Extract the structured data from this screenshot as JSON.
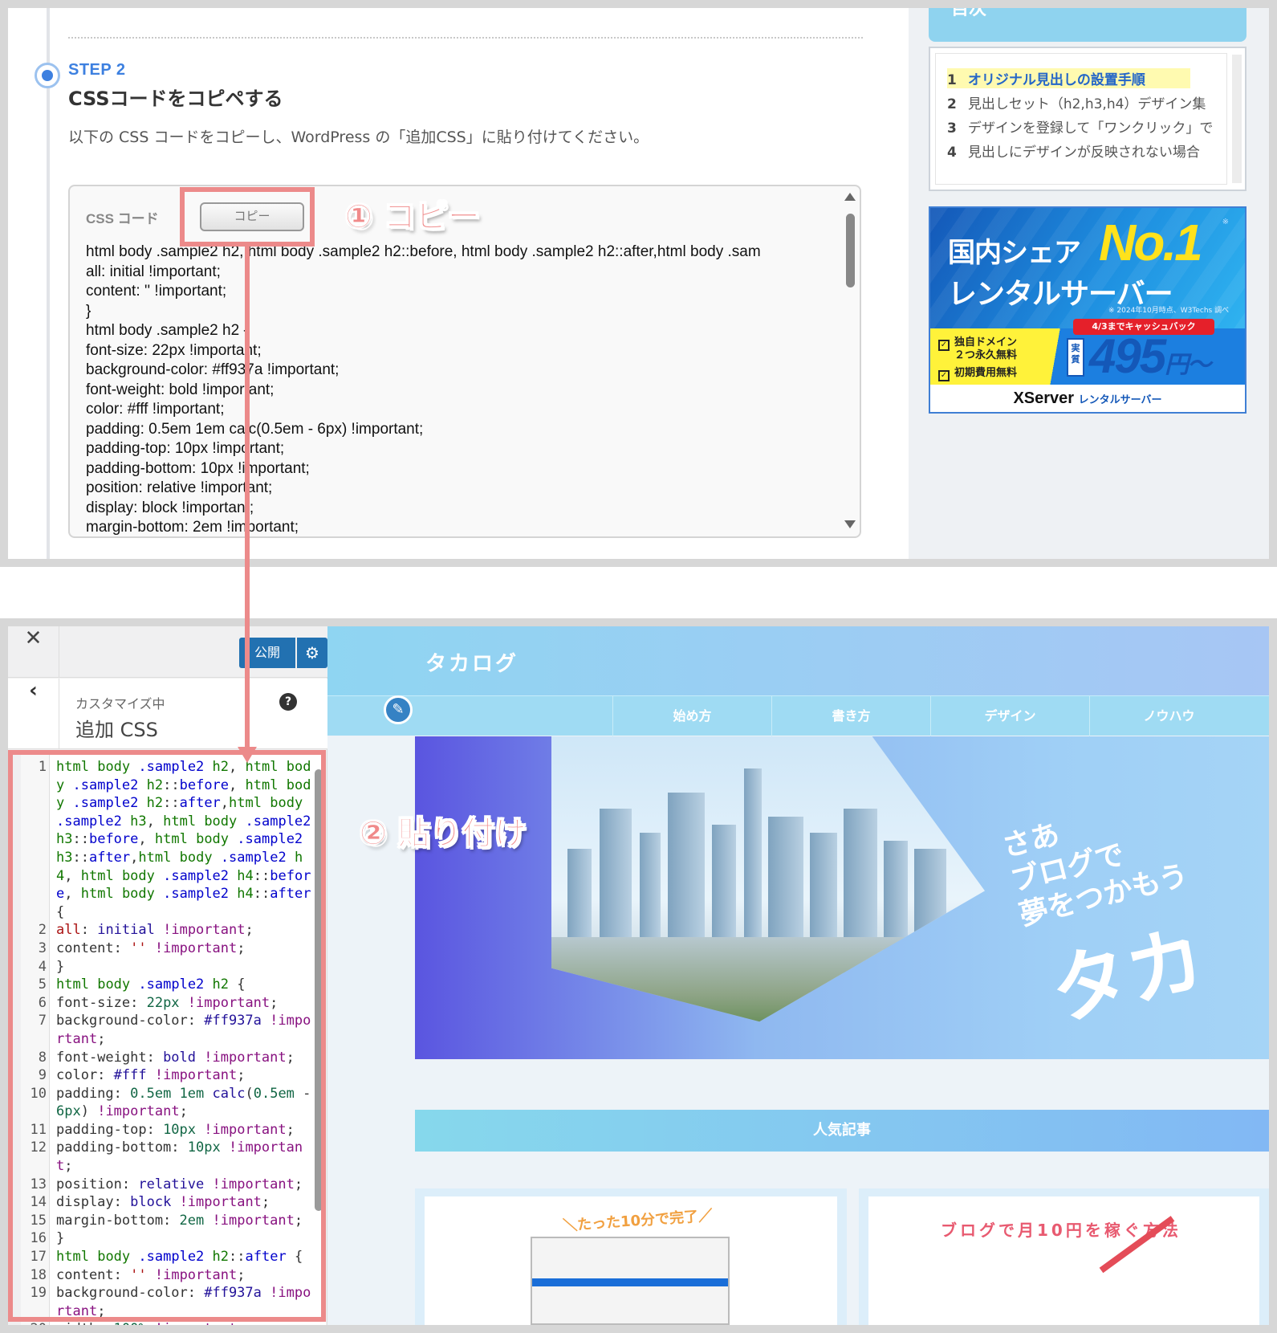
{
  "top": {
    "step_label": "STEP 2",
    "step_title": "CSSコードをコピペする",
    "step_desc": "以下の CSS コードをコピーし、WordPress の「追加CSS」に貼り付けてください。",
    "code_box": {
      "label": "CSS コード",
      "copy_button": "コピー",
      "lines": [
        "html body .sample2 h2, html body .sample2 h2::before, html body .sample2 h2::after,html body .sam",
        "all: initial !important;",
        "content: '' !important;",
        "}",
        "html body .sample2 h2 {",
        "font-size: 22px !important;",
        "background-color: #ff937a !important;",
        "font-weight: bold !important;",
        "color: #fff !important;",
        "padding: 0.5em 1em calc(0.5em - 6px) !important;",
        "padding-top: 10px !important;",
        "padding-bottom: 10px !important;",
        "position: relative !important;",
        "display: block !important;",
        "margin-bottom: 2em !important;"
      ]
    },
    "toc": {
      "title": "目次",
      "items": [
        {
          "num": "1",
          "label": "オリジナル見出しの設置手順"
        },
        {
          "num": "2",
          "label": "見出しセット（h2,h3,h4）デザイン集"
        },
        {
          "num": "3",
          "label": "デザインを登録して「ワンクリック」で"
        },
        {
          "num": "4",
          "label": "見出しにデザインが反映されない場合"
        }
      ]
    },
    "ad": {
      "line1": "国内シェア",
      "no1": "No.1",
      "line2": "レンタルサーバー",
      "note": "※ 2024年10月時点、W3Techs 調べ",
      "cashback": "4/3までキャッシュバック",
      "check1": "独自ドメイン",
      "check1b": "２つ永久無料",
      "check2": "初期費用無料",
      "price_tag": "実質",
      "price": "495",
      "price_unit": "円〜",
      "brand": "XServer",
      "brand_sub": "レンタルサーバー"
    },
    "annotation_copy": "① コピー"
  },
  "bottom": {
    "customizer": {
      "publish": "公開",
      "sub": "カスタマイズ中",
      "title": "追加 CSS"
    },
    "annotation_paste": "② 貼り付け",
    "preview": {
      "logo": "タカログ",
      "nav": [
        "始め方",
        "書き方",
        "デザイン",
        "ノウハウ"
      ],
      "hero_text": [
        "さあ",
        "ブログで",
        "夢をつかもう"
      ],
      "hero_big": "タカ",
      "popular": "人気記事",
      "card1_title": "＼たった10分で完了／",
      "card2_title": "ブログで月10円を稼ぐ方法"
    }
  }
}
